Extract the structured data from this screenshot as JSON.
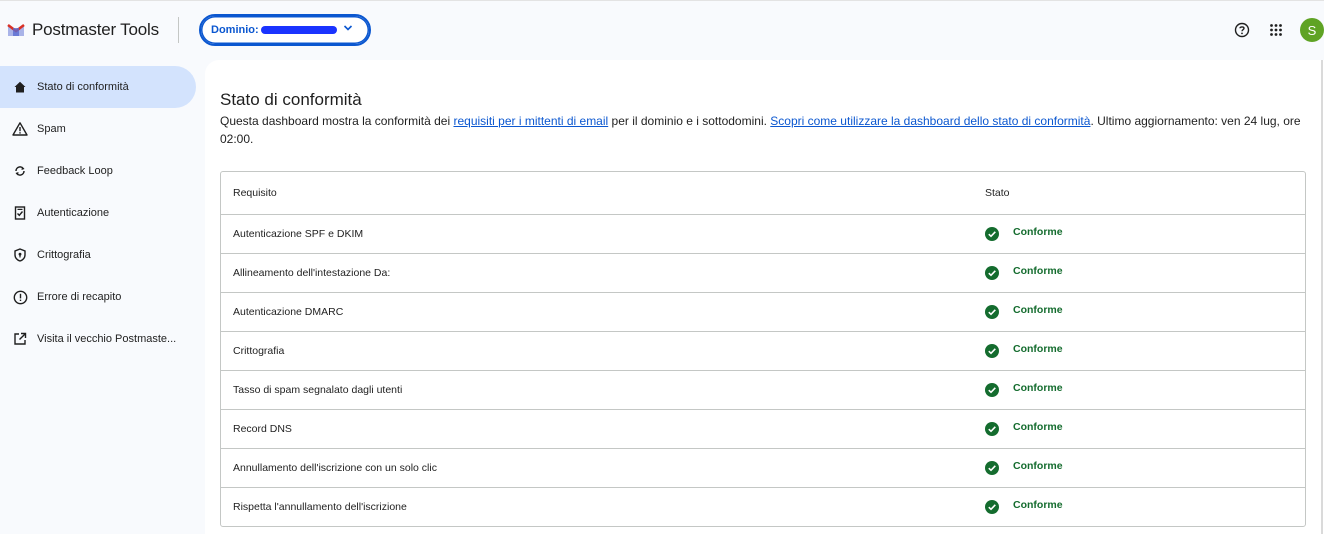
{
  "header": {
    "app_title": "Postmaster Tools",
    "domain_label": "Dominio:",
    "icons": [
      "help-icon",
      "apps-grid-icon"
    ],
    "avatar_letter": "S",
    "avatar_color": "#5fa324"
  },
  "sidebar": {
    "items": [
      {
        "label": "Stato di conformità",
        "icon": "home-icon",
        "active": true
      },
      {
        "label": "Spam",
        "icon": "warning-icon"
      },
      {
        "label": "Feedback Loop",
        "icon": "sync-icon"
      },
      {
        "label": "Autenticazione",
        "icon": "verified-document-icon"
      },
      {
        "label": "Crittografia",
        "icon": "shield-icon"
      },
      {
        "label": "Errore di recapito",
        "icon": "error-circle-icon"
      },
      {
        "label": "Visita il vecchio Postmaste...",
        "icon": "open-in-new-icon"
      }
    ]
  },
  "main": {
    "title": "Stato di conformità",
    "desc": {
      "part1": "Questa dashboard mostra la conformità dei ",
      "link1": "requisiti per i mittenti di email",
      "part2": " per il dominio e i sottodomini. ",
      "link2": "Scopri come utilizzare la dashboard dello stato di conformità",
      "part3": ". Ultimo aggiornamento: ven 24 lug, ore 02:00."
    },
    "table": {
      "headers": [
        "Requisito",
        "Stato"
      ],
      "rows": [
        {
          "requirement": "Autenticazione SPF e DKIM",
          "status": "Conforme"
        },
        {
          "requirement": "Allineamento dell'intestazione Da:",
          "status": "Conforme"
        },
        {
          "requirement": "Autenticazione DMARC",
          "status": "Conforme"
        },
        {
          "requirement": "Crittografia",
          "status": "Conforme"
        },
        {
          "requirement": "Tasso di spam segnalato dagli utenti",
          "status": "Conforme"
        },
        {
          "requirement": "Record DNS",
          "status": "Conforme"
        },
        {
          "requirement": "Annullamento dell'iscrizione con un solo clic",
          "status": "Conforme"
        },
        {
          "requirement": "Rispetta l'annullamento dell'iscrizione",
          "status": "Conforme"
        }
      ]
    }
  },
  "colors": {
    "accent": "#0b57d0",
    "active_nav": "#d3e3fd",
    "success": "#146c2e"
  }
}
